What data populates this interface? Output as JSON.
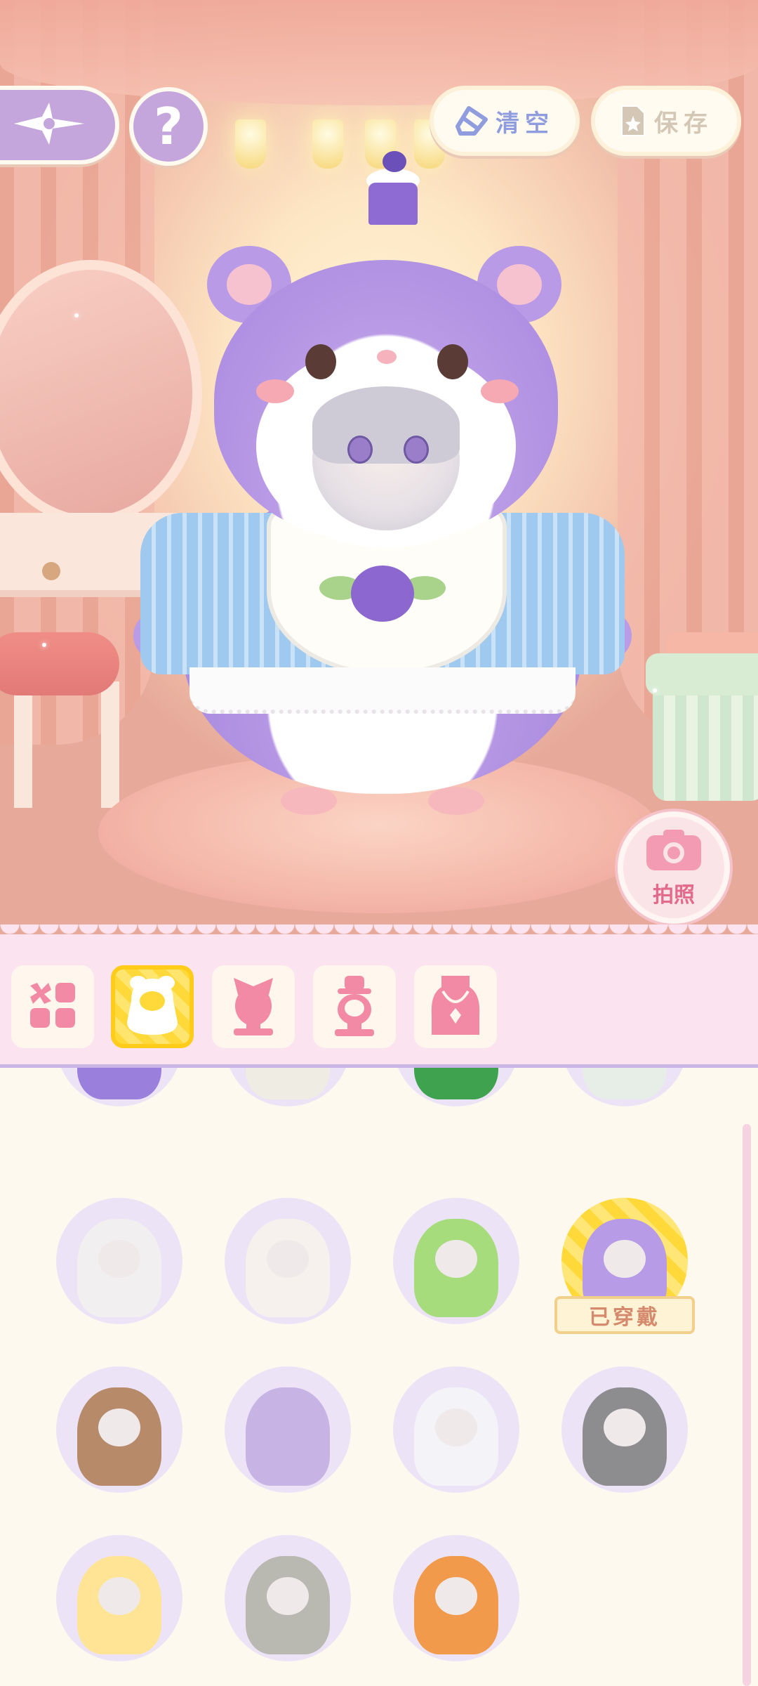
{
  "top_bar": {
    "clear_label": "清空",
    "save_label": "保存"
  },
  "photo_button": {
    "label": "拍照"
  },
  "categories": [
    {
      "name": "all",
      "icon": "grid-icon",
      "active": false
    },
    {
      "name": "hamster-suit",
      "icon": "hamster-suit-icon",
      "active": true
    },
    {
      "name": "hair",
      "icon": "hair-bow-icon",
      "active": false
    },
    {
      "name": "hat",
      "icon": "hat-icon",
      "active": false
    },
    {
      "name": "necklace",
      "icon": "necklace-icon",
      "active": false
    }
  ],
  "items": [
    {
      "color": "#9b7fdc",
      "face": false
    },
    {
      "color": "#efece3",
      "face": false
    },
    {
      "color": "#3ea24f",
      "face": true
    },
    {
      "color": "#e7ede7",
      "face": true
    },
    {
      "color": "#f1efef",
      "face": true
    },
    {
      "color": "#f7f1ee",
      "face": true
    },
    {
      "color": "#a6dc7c",
      "face": true
    },
    {
      "color": "#b79be6",
      "face": true,
      "worn": true
    },
    {
      "color": "#b78a6a",
      "face": true
    },
    {
      "color": "#c7b3e4",
      "face": false
    },
    {
      "color": "#f3f3f8",
      "face": true
    },
    {
      "color": "#8d8d90",
      "face": true
    },
    {
      "color": "#ffe495",
      "face": true
    },
    {
      "color": "#b9b8b1",
      "face": true
    },
    {
      "color": "#f19a4b",
      "face": true
    }
  ],
  "worn_badge_label": "已穿戴",
  "colors": {
    "accent_purple": "#c4a6dd",
    "accent_pink": "#e26a8b",
    "highlight_yellow": "#ffd83a"
  }
}
